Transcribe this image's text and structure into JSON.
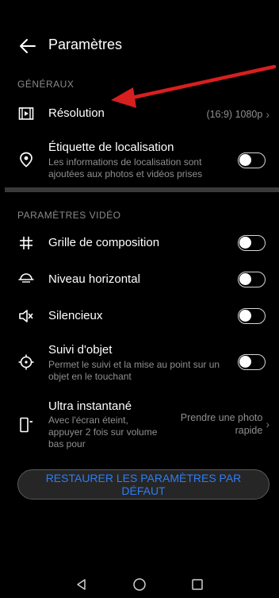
{
  "header": {
    "title": "Paramètres"
  },
  "sections": {
    "general": "GÉNÉRAUX",
    "video": "PARAMÈTRES VIDÉO"
  },
  "rows": {
    "resolution": {
      "label": "Résolution",
      "value": "(16:9) 1080p"
    },
    "location": {
      "label": "Étiquette de localisation",
      "sub": "Les informations de localisation sont ajoutées aux photos et vidéos prises"
    },
    "grid": {
      "label": "Grille de composition"
    },
    "level": {
      "label": "Niveau horizontal"
    },
    "mute": {
      "label": "Silencieux"
    },
    "tracking": {
      "label": "Suivi d'objet",
      "sub": "Permet le suivi et la mise au point sur un objet en le touchant"
    },
    "ultra": {
      "label": "Ultra instantané",
      "sub": "Avec l'écran éteint, appuyer 2 fois sur volume bas pour",
      "value_line1": "Prendre une photo",
      "value_line2": "rapide"
    }
  },
  "toggles": {
    "location": false,
    "grid": false,
    "level": false,
    "mute": false,
    "tracking": false
  },
  "restore_button": "RESTAURER LES PARAMÈTRES PAR DÉFAUT",
  "colors": {
    "accent": "#2f7df6",
    "annotation_arrow": "#d81f1f"
  },
  "icons": {
    "back": "back-arrow-icon",
    "resolution": "resolution-icon",
    "location": "location-pin-icon",
    "grid": "grid-icon",
    "level": "horizontal-level-icon",
    "mute": "mute-icon",
    "tracking": "target-icon",
    "ultra": "ultra-snapshot-icon"
  }
}
